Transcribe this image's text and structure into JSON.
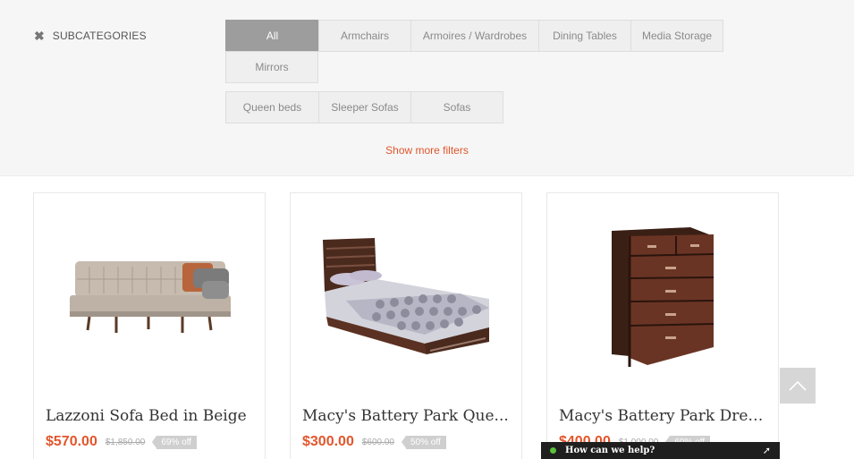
{
  "filters": {
    "toggle_label": "SUBCATEGORIES",
    "chips": [
      "All",
      "Armchairs",
      "Armoires / Wardrobes",
      "Dining Tables",
      "Media Storage",
      "Mirrors",
      "Queen beds",
      "Sleeper Sofas",
      "Sofas"
    ],
    "active_chip": "All",
    "show_more": "Show more filters"
  },
  "products": [
    {
      "title": "Lazzoni Sofa Bed in Beige",
      "price": "$570.00",
      "old_price": "$1,850.00",
      "discount": "69% off"
    },
    {
      "title": "Macy's Battery Park Que...",
      "price": "$300.00",
      "old_price": "$600.00",
      "discount": "50% off"
    },
    {
      "title": "Macy's Battery Park Dres...",
      "price": "$400.00",
      "old_price": "$1,000.00",
      "discount": "60% off"
    }
  ],
  "chat": {
    "label": "How can we help?",
    "status_color": "#58c23a"
  },
  "colors": {
    "accent": "#e2562c",
    "active_chip": "#9d9d9d"
  },
  "icons": {
    "close": "close-icon",
    "scroll_top": "chevron-up-icon",
    "chat_expand": "expand-arrow-icon"
  }
}
